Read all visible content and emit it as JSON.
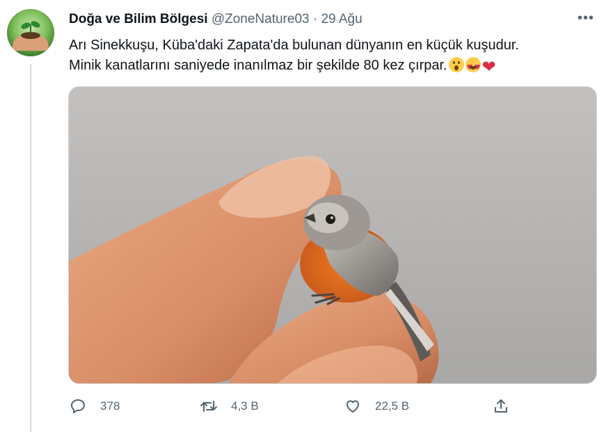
{
  "tweet": {
    "author_name": "Doğa ve Bilim Bölgesi",
    "handle": "@ZoneNature03",
    "separator": "·",
    "date": "29 Ağu",
    "more_label": "•••",
    "text_line1": "Arı Sinekkuşu, Küba'daki Zapata'da bulunan dünyanın en küçük kuşudur.",
    "text_line2": "Minik kanatlarını saniyede inanılmaz bir şekilde 80 kez çırpar.",
    "emojis": [
      "astonished-face",
      "heart-eyes-face",
      "red-heart"
    ]
  },
  "actions": {
    "reply_count": "378",
    "retweet_count": "4,3 B",
    "like_count": "22,5 B"
  },
  "icons": {
    "reply": "reply-icon",
    "retweet": "retweet-icon",
    "like": "like-icon",
    "share": "share-icon"
  },
  "colors": {
    "text": "#0f1419",
    "secondary": "#536471",
    "border": "#cfd9de"
  }
}
